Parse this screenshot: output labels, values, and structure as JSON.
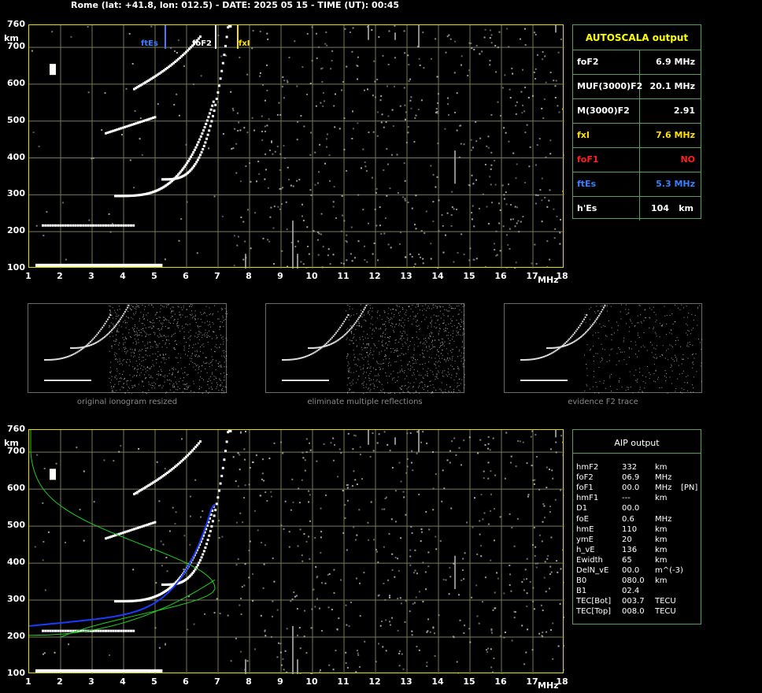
{
  "header": {
    "title": "Rome (lat: +41.8, lon: 012.5) - DATE: 2025 05 15 - TIME (UT): 00:45"
  },
  "axes": {
    "y_unit": "km",
    "x_unit": "MHz",
    "y_ticks": [
      "760",
      "700",
      "600",
      "500",
      "400",
      "300",
      "200",
      "100"
    ],
    "x_ticks": [
      "1",
      "2",
      "3",
      "4",
      "5",
      "6",
      "7",
      "8",
      "9",
      "10",
      "11",
      "12",
      "13",
      "14",
      "15",
      "16",
      "17",
      "18"
    ]
  },
  "markers": {
    "ftEs": {
      "label": "ftEs",
      "freq": 5.3,
      "color": "#3a7fff"
    },
    "foF2": {
      "label": "foF2",
      "freq": 6.9,
      "color": "#ffffff"
    },
    "fxI": {
      "label": "fxI",
      "freq": 7.6,
      "color": "#ffe000"
    }
  },
  "autoscala": {
    "title": "AUTOSCALA output",
    "rows": [
      {
        "label": "foF2",
        "value": "6.9 MHz",
        "color": "#ffffff"
      },
      {
        "label": "MUF(3000)F2",
        "value": "20.1 MHz",
        "color": "#ffffff"
      },
      {
        "label": "M(3000)F2",
        "value": "2.91",
        "color": "#ffffff"
      },
      {
        "label": "fxI",
        "value": "7.6 MHz",
        "color": "#ffe000"
      },
      {
        "label": "foF1",
        "value": "NO",
        "color": "#ff2020"
      },
      {
        "label": "ftEs",
        "value": "5.3 MHz",
        "color": "#3a7fff"
      },
      {
        "label": "h'Es",
        "value": "104",
        "unit": "km",
        "color": "#ffffff"
      }
    ]
  },
  "thumbnails": [
    {
      "caption": "original ionogram resized"
    },
    {
      "caption": "eliminate multiple reflections"
    },
    {
      "caption": "evidence F2 trace"
    }
  ],
  "aip": {
    "title": "AIP output",
    "rows": [
      {
        "name": "hmF2",
        "value": "332",
        "unit": "km",
        "extra": ""
      },
      {
        "name": "foF2",
        "value": "06.9",
        "unit": "MHz",
        "extra": ""
      },
      {
        "name": "foF1",
        "value": "00.0",
        "unit": "MHz",
        "extra": "[PN]"
      },
      {
        "name": "hmF1",
        "value": "---",
        "unit": "km",
        "extra": ""
      },
      {
        "name": "D1",
        "value": "00.0",
        "unit": "",
        "extra": ""
      },
      {
        "name": "foE",
        "value": "0.6",
        "unit": "MHz",
        "extra": ""
      },
      {
        "name": "hmE",
        "value": "110",
        "unit": "km",
        "extra": ""
      },
      {
        "name": "ymE",
        "value": "20",
        "unit": "km",
        "extra": ""
      },
      {
        "name": "h_vE",
        "value": "136",
        "unit": "km",
        "extra": ""
      },
      {
        "name": "Ewidth",
        "value": "65",
        "unit": "km",
        "extra": ""
      },
      {
        "name": "DelN_vE",
        "value": "00.0",
        "unit": "m^(-3)",
        "extra": ""
      },
      {
        "name": "B0",
        "value": "080.0",
        "unit": "km",
        "extra": ""
      },
      {
        "name": "B1",
        "value": "02.4",
        "unit": "",
        "extra": ""
      },
      {
        "name": "TEC[Bot]",
        "value": "003.7",
        "unit": "TECU",
        "extra": ""
      },
      {
        "name": "TEC[Top]",
        "value": "008.0",
        "unit": "TECU",
        "extra": ""
      }
    ]
  },
  "colors": {
    "frame": "#e6e000",
    "grid": "#7a7a58",
    "panel_border": "#5aa05a",
    "trace": "#ffffff",
    "profile_green": "#20d020",
    "profile_blue": "#1a3cff",
    "noise": "#b0b0b0"
  }
}
